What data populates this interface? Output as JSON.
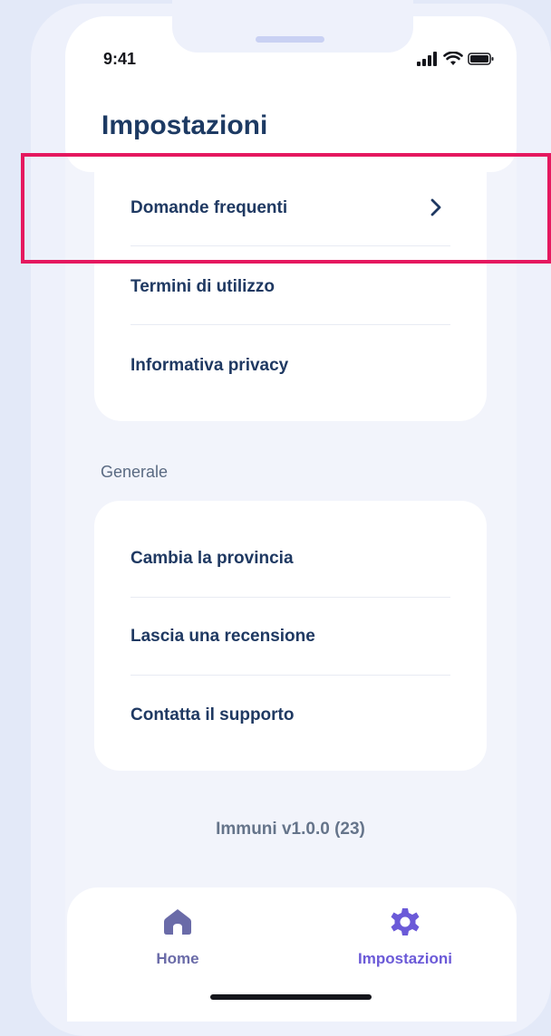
{
  "status_bar": {
    "time": "9:41"
  },
  "header": {
    "title": "Impostazioni"
  },
  "info_items": [
    {
      "label": "Domande frequenti"
    },
    {
      "label": "Termini di utilizzo"
    },
    {
      "label": "Informativa privacy"
    }
  ],
  "general": {
    "section_label": "Generale",
    "items": [
      {
        "label": "Cambia la provincia"
      },
      {
        "label": "Lascia una recensione"
      },
      {
        "label": "Contatta il supporto"
      }
    ]
  },
  "version": "Immuni  v1.0.0 (23)",
  "tabbar": {
    "tabs": [
      {
        "label": "Home",
        "icon": "home-icon",
        "active": false
      },
      {
        "label": "Impostazioni",
        "icon": "gear-icon",
        "active": true
      }
    ]
  },
  "colors": {
    "title": "#1d3a63",
    "active_tab": "#6b5ad8",
    "highlight": "#e5185f",
    "background": "#e3e9f8"
  },
  "icons": [
    "chevron-right-icon",
    "signal-icon",
    "wifi-icon",
    "battery-icon",
    "home-icon",
    "gear-icon"
  ]
}
